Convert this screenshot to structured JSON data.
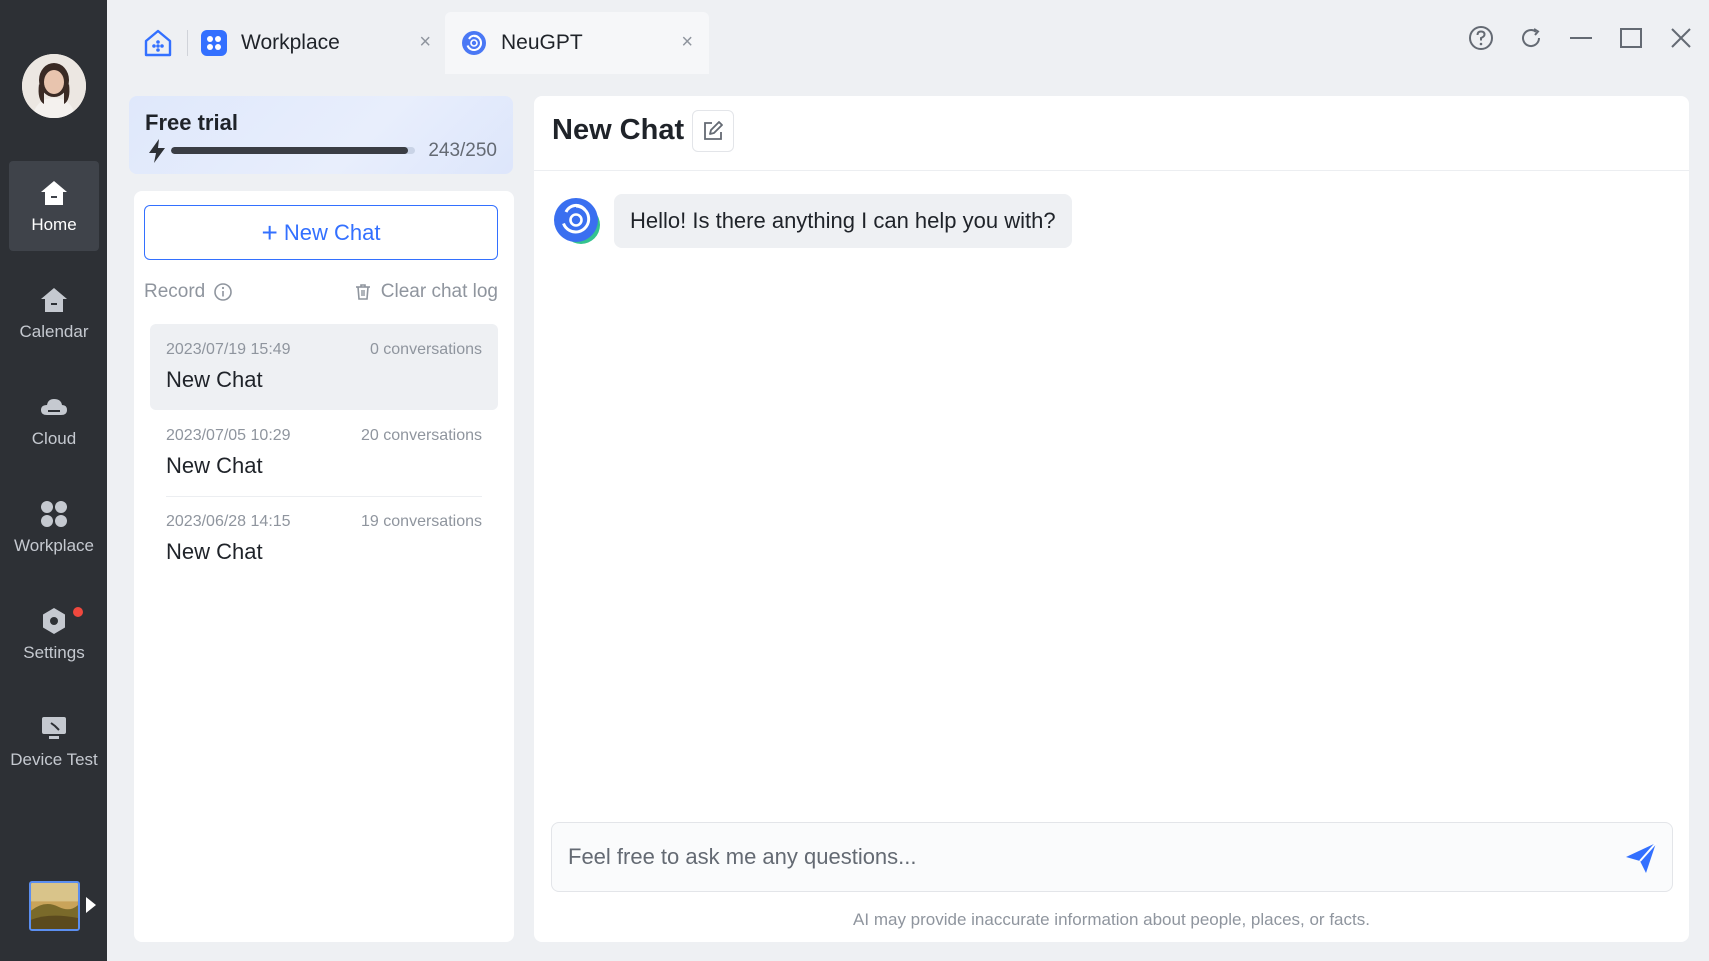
{
  "sidebar": {
    "items": [
      {
        "label": "Home",
        "icon": "home-icon",
        "active": true
      },
      {
        "label": "Calendar",
        "icon": "calendar-icon"
      },
      {
        "label": "Cloud",
        "icon": "cloud-icon"
      },
      {
        "label": "Workplace",
        "icon": "workplace-icon"
      },
      {
        "label": "Settings",
        "icon": "settings-icon",
        "notification": true
      },
      {
        "label": "Device Test",
        "icon": "device-test-icon"
      }
    ]
  },
  "tabs": [
    {
      "label": "Workplace",
      "icon": "workplace-app-icon",
      "close": "×"
    },
    {
      "label": "NeuGPT",
      "icon": "neugpt-icon",
      "close": "×",
      "active": true
    }
  ],
  "trial": {
    "title": "Free trial",
    "used": 243,
    "total": 250,
    "count_text": "243/250"
  },
  "panel": {
    "new_chat_label": "New Chat",
    "record_label": "Record",
    "clear_label": "Clear chat log"
  },
  "chats": [
    {
      "date": "2023/07/19 15:49",
      "count": "0 conversations",
      "title": "New Chat"
    },
    {
      "date": "2023/07/05 10:29",
      "count": "20 conversations",
      "title": "New Chat"
    },
    {
      "date": "2023/06/28 14:15",
      "count": "19 conversations",
      "title": "New Chat"
    }
  ],
  "main": {
    "title": "New Chat",
    "bot_message": "Hello! Is there anything I can help you with?",
    "input_placeholder": "Feel free to ask me any questions...",
    "disclaimer": "AI may provide inaccurate information about people, places, or facts."
  },
  "colors": {
    "accent": "#3370ff",
    "rail": "#2d3035",
    "badge": "#f0483e"
  }
}
